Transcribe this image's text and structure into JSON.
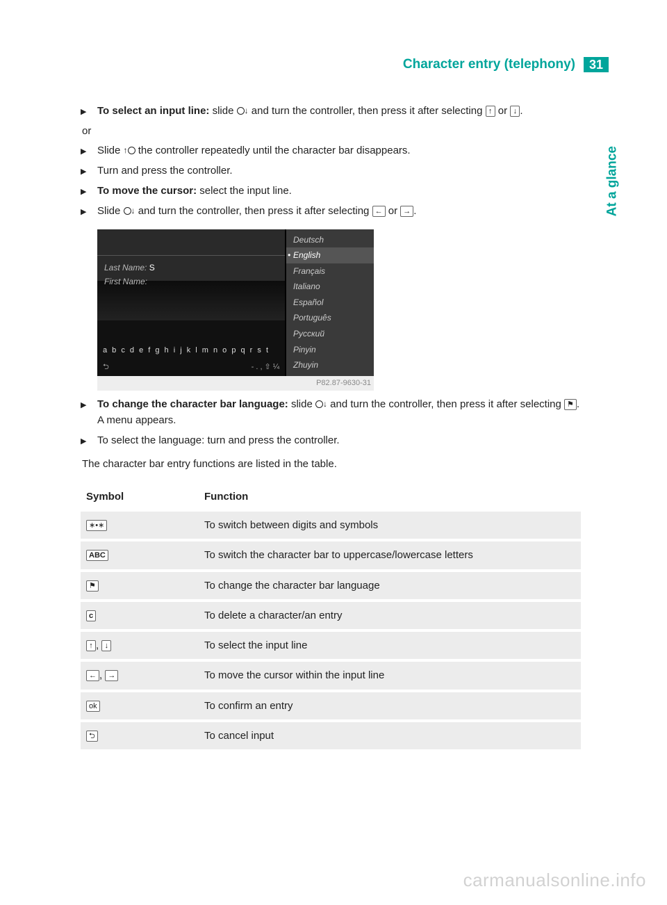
{
  "header": {
    "title": "Character entry (telephony)",
    "page_number": "31",
    "side_tab": "At a glance"
  },
  "steps": {
    "s1_bold": "To select an input line:",
    "s1_rest_a": " slide ",
    "s1_rest_b": " and turn the controller, then press it after selecting ",
    "s1_or": " or ",
    "s1_end": ".",
    "or_line": "or",
    "s2_a": "Slide ",
    "s2_b": " the controller repeatedly until the character bar disappears.",
    "s3": "Turn and press the controller.",
    "s4_bold": "To move the cursor:",
    "s4_rest": " select the input line.",
    "s5_a": "Slide ",
    "s5_b": " and turn the controller, then press it after selecting ",
    "s5_or": " or ",
    "s5_end": ".",
    "s6_bold": "To change the character bar language:",
    "s6_rest_a": " slide ",
    "s6_rest_b": " and turn the controller, then press it after selecting ",
    "s6_end": ".",
    "s6_sub": "A menu appears.",
    "s7": "To select the language: turn and press the controller.",
    "para": "The character bar entry functions are listed in the table."
  },
  "screenshot": {
    "last_name_label": "Last Name: ",
    "last_name_value": "S",
    "first_name_label": "First Name:",
    "alpha_row": "a b c d e f g h i j k l m n o p q r s t",
    "bottom_left": "⮌",
    "bottom_right": "- . , ⇧ ¼",
    "langs": [
      "Deutsch",
      "English",
      "Français",
      "Italiano",
      "Español",
      "Português",
      "Русский",
      "Pinyin",
      "Zhuyin"
    ],
    "selected_lang_index": 1,
    "caption": "P82.87-9630-31"
  },
  "table": {
    "h1": "Symbol",
    "h2": "Function",
    "rows": [
      {
        "sym_html": "dots",
        "fn": "To switch between digits and symbols"
      },
      {
        "sym_html": "abc",
        "fn": "To switch the character bar to uppercase/lowercase letters"
      },
      {
        "sym_html": "flag",
        "fn": "To change the character bar language"
      },
      {
        "sym_html": "c",
        "fn": "To delete a character/an entry"
      },
      {
        "sym_html": "updown",
        "fn": "To select the input line"
      },
      {
        "sym_html": "leftright",
        "fn": "To move the cursor within the input line"
      },
      {
        "sym_html": "ok",
        "fn": "To confirm an entry"
      },
      {
        "sym_html": "back",
        "fn": "To cancel input"
      }
    ]
  },
  "symbols": {
    "dots": "∗•∗",
    "abc": "ABC",
    "flag": "⚑",
    "c": "c",
    "ok": "ok",
    "back": "⮌",
    "up": "↑",
    "down": "↓",
    "left": "←",
    "right": "→",
    "comma": ", "
  },
  "watermark": "carmanualsonline.info"
}
